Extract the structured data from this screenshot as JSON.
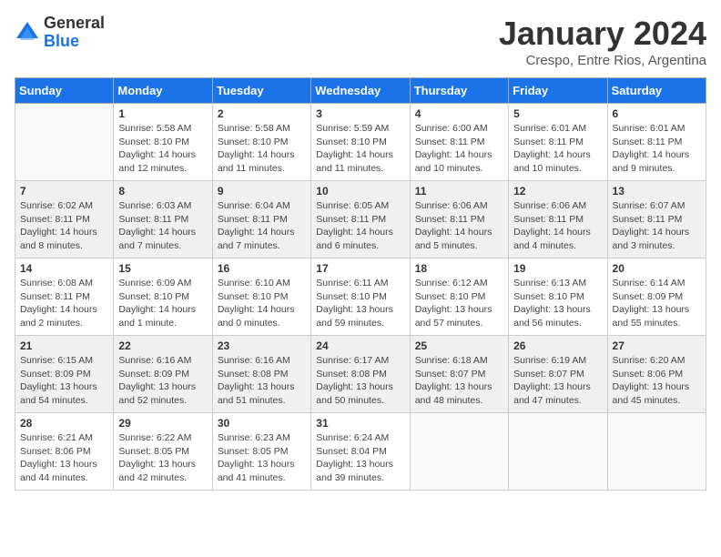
{
  "logo": {
    "general": "General",
    "blue": "Blue"
  },
  "title": "January 2024",
  "subtitle": "Crespo, Entre Rios, Argentina",
  "days_header": [
    "Sunday",
    "Monday",
    "Tuesday",
    "Wednesday",
    "Thursday",
    "Friday",
    "Saturday"
  ],
  "weeks": [
    [
      {
        "day": "",
        "info": ""
      },
      {
        "day": "1",
        "info": "Sunrise: 5:58 AM\nSunset: 8:10 PM\nDaylight: 14 hours\nand 12 minutes."
      },
      {
        "day": "2",
        "info": "Sunrise: 5:58 AM\nSunset: 8:10 PM\nDaylight: 14 hours\nand 11 minutes."
      },
      {
        "day": "3",
        "info": "Sunrise: 5:59 AM\nSunset: 8:10 PM\nDaylight: 14 hours\nand 11 minutes."
      },
      {
        "day": "4",
        "info": "Sunrise: 6:00 AM\nSunset: 8:11 PM\nDaylight: 14 hours\nand 10 minutes."
      },
      {
        "day": "5",
        "info": "Sunrise: 6:01 AM\nSunset: 8:11 PM\nDaylight: 14 hours\nand 10 minutes."
      },
      {
        "day": "6",
        "info": "Sunrise: 6:01 AM\nSunset: 8:11 PM\nDaylight: 14 hours\nand 9 minutes."
      }
    ],
    [
      {
        "day": "7",
        "info": "Sunrise: 6:02 AM\nSunset: 8:11 PM\nDaylight: 14 hours\nand 8 minutes."
      },
      {
        "day": "8",
        "info": "Sunrise: 6:03 AM\nSunset: 8:11 PM\nDaylight: 14 hours\nand 7 minutes."
      },
      {
        "day": "9",
        "info": "Sunrise: 6:04 AM\nSunset: 8:11 PM\nDaylight: 14 hours\nand 7 minutes."
      },
      {
        "day": "10",
        "info": "Sunrise: 6:05 AM\nSunset: 8:11 PM\nDaylight: 14 hours\nand 6 minutes."
      },
      {
        "day": "11",
        "info": "Sunrise: 6:06 AM\nSunset: 8:11 PM\nDaylight: 14 hours\nand 5 minutes."
      },
      {
        "day": "12",
        "info": "Sunrise: 6:06 AM\nSunset: 8:11 PM\nDaylight: 14 hours\nand 4 minutes."
      },
      {
        "day": "13",
        "info": "Sunrise: 6:07 AM\nSunset: 8:11 PM\nDaylight: 14 hours\nand 3 minutes."
      }
    ],
    [
      {
        "day": "14",
        "info": "Sunrise: 6:08 AM\nSunset: 8:11 PM\nDaylight: 14 hours\nand 2 minutes."
      },
      {
        "day": "15",
        "info": "Sunrise: 6:09 AM\nSunset: 8:10 PM\nDaylight: 14 hours\nand 1 minute."
      },
      {
        "day": "16",
        "info": "Sunrise: 6:10 AM\nSunset: 8:10 PM\nDaylight: 14 hours\nand 0 minutes."
      },
      {
        "day": "17",
        "info": "Sunrise: 6:11 AM\nSunset: 8:10 PM\nDaylight: 13 hours\nand 59 minutes."
      },
      {
        "day": "18",
        "info": "Sunrise: 6:12 AM\nSunset: 8:10 PM\nDaylight: 13 hours\nand 57 minutes."
      },
      {
        "day": "19",
        "info": "Sunrise: 6:13 AM\nSunset: 8:10 PM\nDaylight: 13 hours\nand 56 minutes."
      },
      {
        "day": "20",
        "info": "Sunrise: 6:14 AM\nSunset: 8:09 PM\nDaylight: 13 hours\nand 55 minutes."
      }
    ],
    [
      {
        "day": "21",
        "info": "Sunrise: 6:15 AM\nSunset: 8:09 PM\nDaylight: 13 hours\nand 54 minutes."
      },
      {
        "day": "22",
        "info": "Sunrise: 6:16 AM\nSunset: 8:09 PM\nDaylight: 13 hours\nand 52 minutes."
      },
      {
        "day": "23",
        "info": "Sunrise: 6:16 AM\nSunset: 8:08 PM\nDaylight: 13 hours\nand 51 minutes."
      },
      {
        "day": "24",
        "info": "Sunrise: 6:17 AM\nSunset: 8:08 PM\nDaylight: 13 hours\nand 50 minutes."
      },
      {
        "day": "25",
        "info": "Sunrise: 6:18 AM\nSunset: 8:07 PM\nDaylight: 13 hours\nand 48 minutes."
      },
      {
        "day": "26",
        "info": "Sunrise: 6:19 AM\nSunset: 8:07 PM\nDaylight: 13 hours\nand 47 minutes."
      },
      {
        "day": "27",
        "info": "Sunrise: 6:20 AM\nSunset: 8:06 PM\nDaylight: 13 hours\nand 45 minutes."
      }
    ],
    [
      {
        "day": "28",
        "info": "Sunrise: 6:21 AM\nSunset: 8:06 PM\nDaylight: 13 hours\nand 44 minutes."
      },
      {
        "day": "29",
        "info": "Sunrise: 6:22 AM\nSunset: 8:05 PM\nDaylight: 13 hours\nand 42 minutes."
      },
      {
        "day": "30",
        "info": "Sunrise: 6:23 AM\nSunset: 8:05 PM\nDaylight: 13 hours\nand 41 minutes."
      },
      {
        "day": "31",
        "info": "Sunrise: 6:24 AM\nSunset: 8:04 PM\nDaylight: 13 hours\nand 39 minutes."
      },
      {
        "day": "",
        "info": ""
      },
      {
        "day": "",
        "info": ""
      },
      {
        "day": "",
        "info": ""
      }
    ]
  ]
}
